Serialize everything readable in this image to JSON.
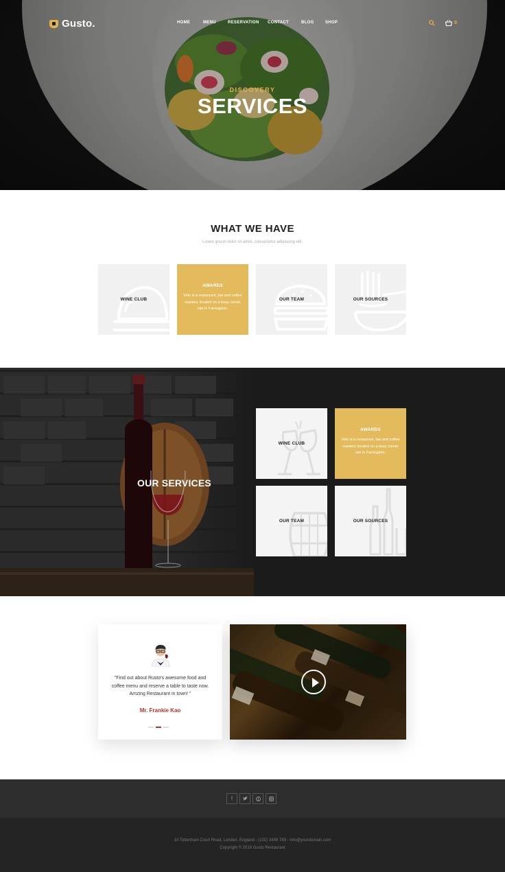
{
  "header": {
    "logo": "Gusto.",
    "menu": [
      "HOME",
      "MENU",
      "RESERVATION",
      "CONTACT",
      "BLOG",
      "SHOP"
    ],
    "cart_count": "0"
  },
  "hero": {
    "subtitle": "DISCOVERY",
    "title": "SERVICES"
  },
  "what_we_have": {
    "title": "WHAT WE HAVE",
    "subtitle": "Lorem ipsum dolor sit amet, consectetur adipiscing elit.",
    "cards": [
      {
        "label": "WINE CLUB",
        "icon": "cloche-icon"
      },
      {
        "label": "AWARDS",
        "desc": "Velu is a restaurant, bar and coffee roastery located on a busy corner site in Farringdon.",
        "highlight": true
      },
      {
        "label": "OUR TEAM",
        "icon": "burger-icon"
      },
      {
        "label": "OUR SOURCES",
        "icon": "noodles-icon"
      }
    ]
  },
  "our_services": {
    "title": "OUR SERVICES",
    "cards": [
      {
        "label": "WINE CLUB",
        "icon": "wine-glasses-icon"
      },
      {
        "label": "AWARDS",
        "desc": "Velu is a restaurant, bar and coffee roastery located on a busy corner site in Farringdon.",
        "highlight": true
      },
      {
        "label": "OUR TEAM",
        "icon": "barrel-icon"
      },
      {
        "label": "OUR SOURCES",
        "icon": "bottles-icon"
      }
    ]
  },
  "testimonial": {
    "quote": "\"Find out about Rusto's awesome food and coffee menu and reserve a table to taste now. Amzing Restaurant in town! \"",
    "author": "Mr. Frankie Kao"
  },
  "footer": {
    "socials": [
      "facebook-icon",
      "twitter-icon",
      "pinterest-icon",
      "instagram-icon"
    ],
    "address": "14 Tottenham Court Road, London, England - (102) 3456 789 - info@yourdomain.com",
    "copyright": "Copyright © 2018 Gusto Restaurant"
  },
  "colors": {
    "accent": "#e3bb5c",
    "author": "#b8332b",
    "dark_bg": "#1b1b1b",
    "footer_top": "#2d2d2d",
    "footer_bottom": "#242424"
  }
}
